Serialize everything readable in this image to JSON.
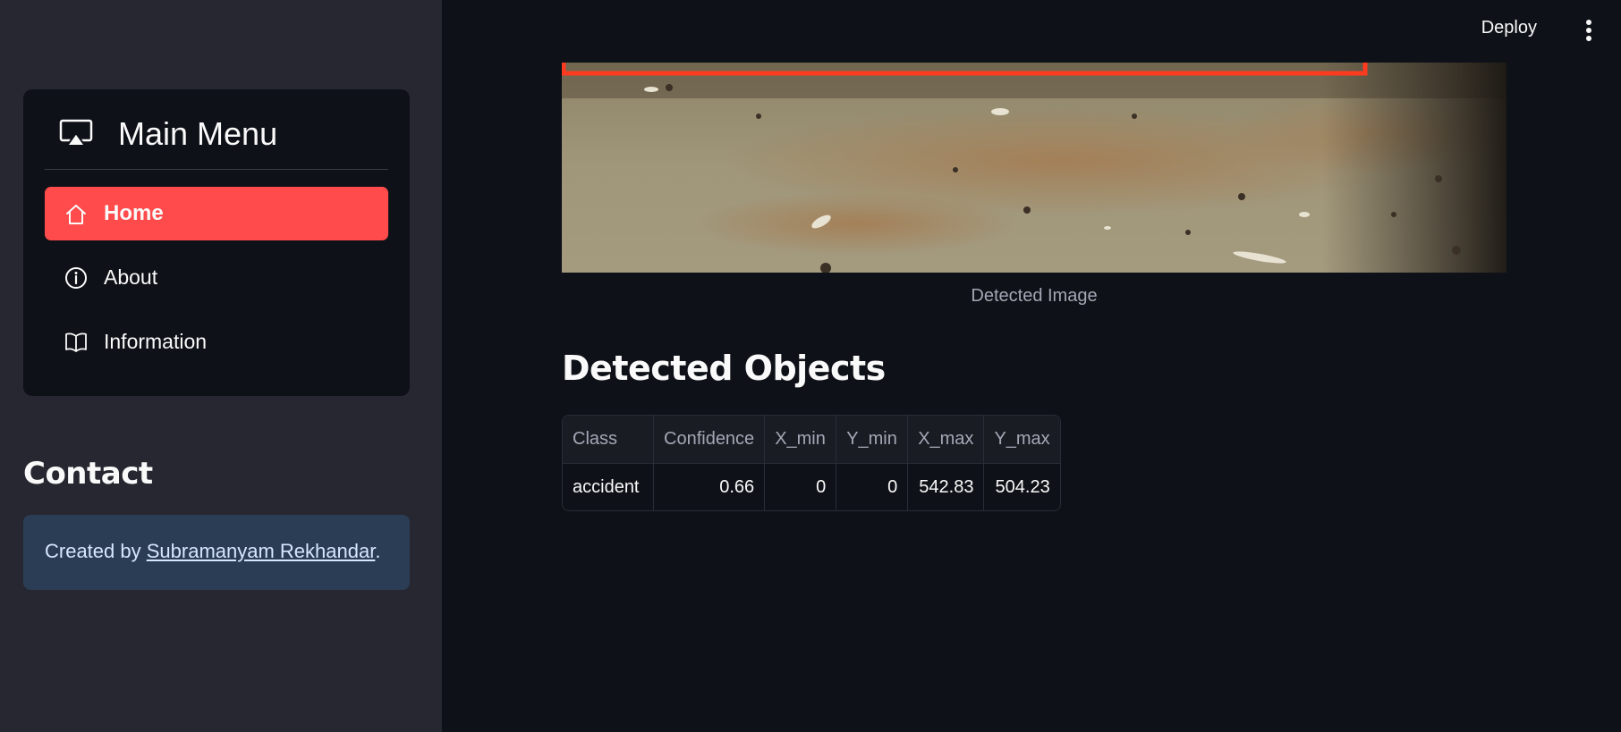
{
  "sidebar": {
    "menu": {
      "title": "Main Menu",
      "items": [
        {
          "label": "Home",
          "icon": "house-icon",
          "active": true
        },
        {
          "label": "About",
          "icon": "info-circle-icon",
          "active": false
        },
        {
          "label": "Information",
          "icon": "book-icon",
          "active": false
        }
      ]
    },
    "contact": {
      "heading": "Contact",
      "prefix": "Created by ",
      "link_text": "Subramanyam Rekhandar",
      "suffix": "."
    }
  },
  "toolbar": {
    "deploy_label": "Deploy"
  },
  "main": {
    "image_caption": "Detected Image",
    "section_heading": "Detected Objects",
    "table": {
      "headers": [
        "Class",
        "Confidence",
        "X_min",
        "Y_min",
        "X_max",
        "Y_max"
      ],
      "rows": [
        [
          "accident",
          "0.66",
          "0",
          "0",
          "542.83",
          "504.23"
        ]
      ]
    }
  },
  "colors": {
    "accent": "#ff4b4b",
    "sidebar_bg": "#262730",
    "main_bg": "#0e1117",
    "contact_bg": "#2b3d55",
    "bbox": "#ff3b1f"
  }
}
